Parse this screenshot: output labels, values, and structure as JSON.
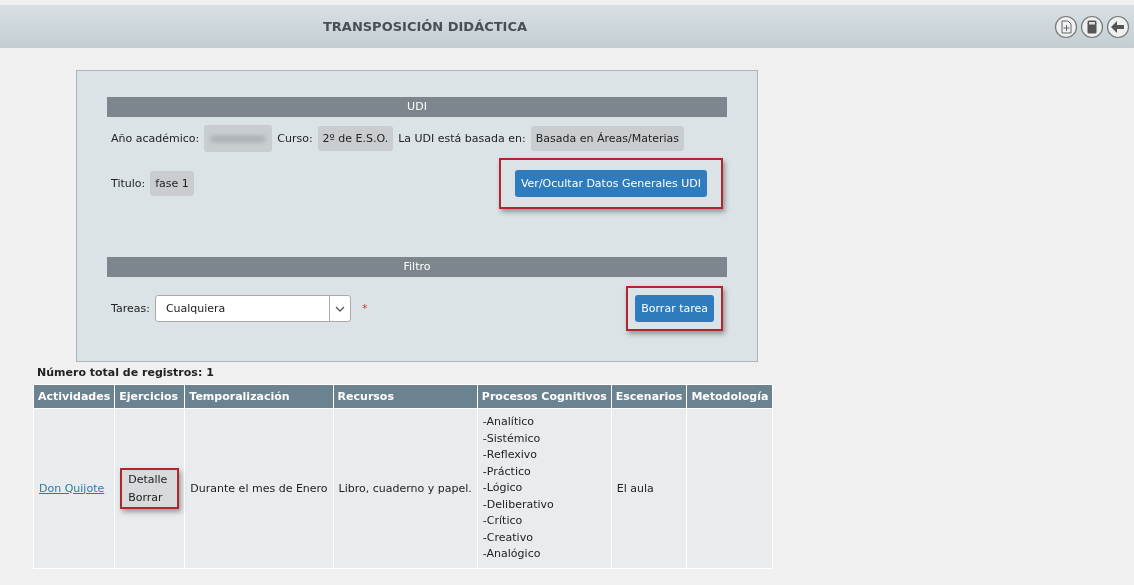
{
  "header": {
    "title": "TRANSPOSICIÓN DIDÁCTICA"
  },
  "udi": {
    "heading": "UDI",
    "fields": [
      {
        "label": "Año académico:",
        "redacted": true
      },
      {
        "label": "Curso:",
        "value": "2º de E.S.O.",
        "redacted": false
      },
      {
        "label": "La UDI está basada en:",
        "value": "Basada en Áreas/Materias",
        "redacted": false
      }
    ],
    "title_label": "Titulo:",
    "title_value": "fase 1",
    "toggle_button": "Ver/Ocultar Datos Generales UDI"
  },
  "filter": {
    "heading": "Filtro",
    "label": "Tareas:",
    "value": "Cualquiera",
    "required_mark": "*",
    "delete_button": "Borrar tarea"
  },
  "records": "Número total de registros: 1",
  "table": {
    "columns": [
      "Actividades",
      "Ejercicios",
      "Temporalización",
      "Recursos",
      "Procesos Cognitivos",
      "Escenarios",
      "Metodología"
    ],
    "rows": [
      {
        "activity": "Don Quijote",
        "menu": [
          "Detalle",
          "Borrar"
        ],
        "timing": "Durante el mes de Enero",
        "resources": "Libro, cuaderno y papel.",
        "processes": [
          "-Analítico",
          "-Sistémico",
          "-Reflexivo",
          "-Práctico",
          "-Lógico",
          "-Deliberativo",
          "-Crítico",
          "-Creativo",
          "-Analógico"
        ],
        "scenario": "El aula"
      }
    ]
  }
}
